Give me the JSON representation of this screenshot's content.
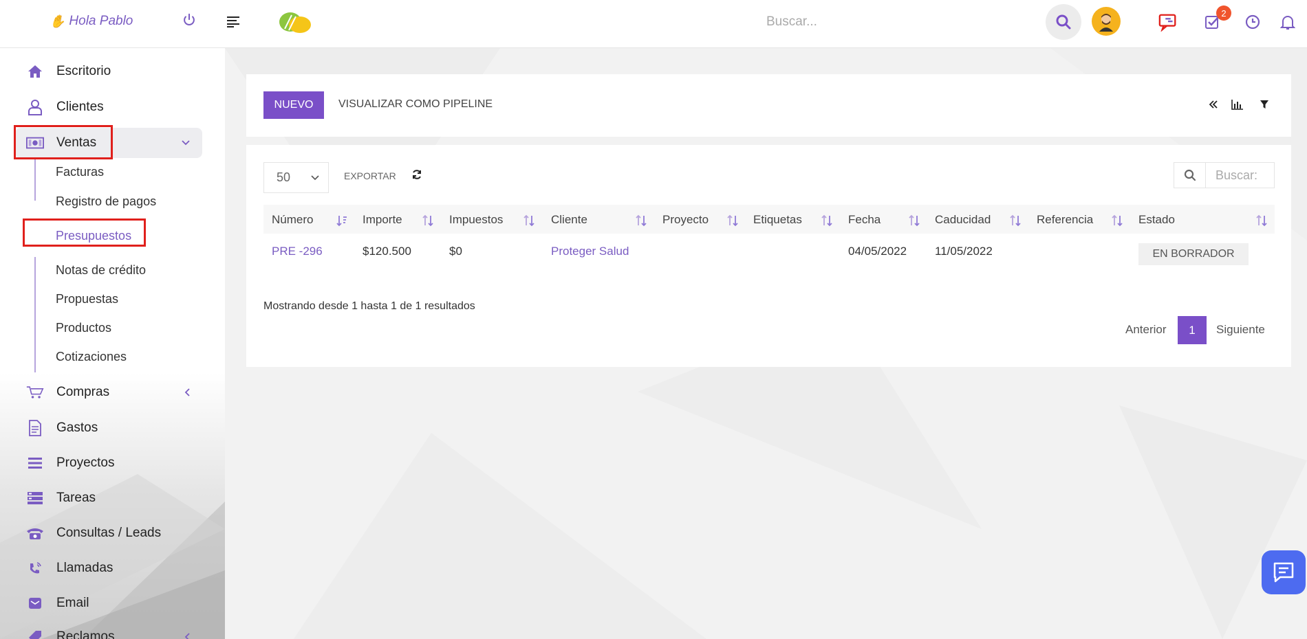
{
  "topbar": {
    "greeting": "Hola Pablo",
    "search_placeholder": "Buscar...",
    "notifications_badge": "2"
  },
  "sidebar": {
    "items": [
      {
        "label": "Escritorio",
        "icon": "home-icon"
      },
      {
        "label": "Clientes",
        "icon": "user-icon"
      },
      {
        "label": "Ventas",
        "icon": "money-icon"
      },
      {
        "label": "Compras",
        "icon": "cart-icon"
      },
      {
        "label": "Gastos",
        "icon": "document-icon"
      },
      {
        "label": "Proyectos",
        "icon": "bars-icon"
      },
      {
        "label": "Tareas",
        "icon": "tasks-icon"
      },
      {
        "label": "Consultas / Leads",
        "icon": "phone-desk-icon"
      },
      {
        "label": "Llamadas",
        "icon": "phone-icon"
      },
      {
        "label": "Email",
        "icon": "email-icon"
      },
      {
        "label": "Reclamos",
        "icon": "tag-icon"
      }
    ],
    "ventas_sub": [
      {
        "label": "Facturas"
      },
      {
        "label": "Registro de pagos"
      },
      {
        "label": "Presupuestos"
      },
      {
        "label": "Notas de crédito"
      },
      {
        "label": "Propuestas"
      },
      {
        "label": "Productos"
      },
      {
        "label": "Cotizaciones"
      }
    ]
  },
  "toolbar": {
    "new_label": "NUEVO",
    "pipeline_label": "VISUALIZAR COMO PIPELINE"
  },
  "table": {
    "per_page": "50",
    "export_label": "EXPORTAR",
    "search_placeholder": "Buscar:",
    "columns": [
      "Número",
      "Importe",
      "Impuestos",
      "Cliente",
      "Proyecto",
      "Etiquetas",
      "Fecha",
      "Caducidad",
      "Referencia",
      "Estado"
    ],
    "rows": [
      {
        "numero": "PRE -296",
        "importe": "$120.500",
        "impuestos": "$0",
        "cliente": "Proteger Salud",
        "proyecto": "",
        "etiquetas": "",
        "fecha": "04/05/2022",
        "caducidad": "11/05/2022",
        "referencia": "",
        "estado": "EN BORRADOR"
      }
    ],
    "info": "Mostrando desde 1 hasta 1 de 1 resultados",
    "prev_label": "Anterior",
    "current_page": "1",
    "next_label": "Siguiente"
  },
  "colors": {
    "accent": "#7a4fc8",
    "link": "#7a5cc2",
    "highlight_box": "#e0201c",
    "badge": "#f0542d",
    "chat": "#4d6bf0"
  }
}
